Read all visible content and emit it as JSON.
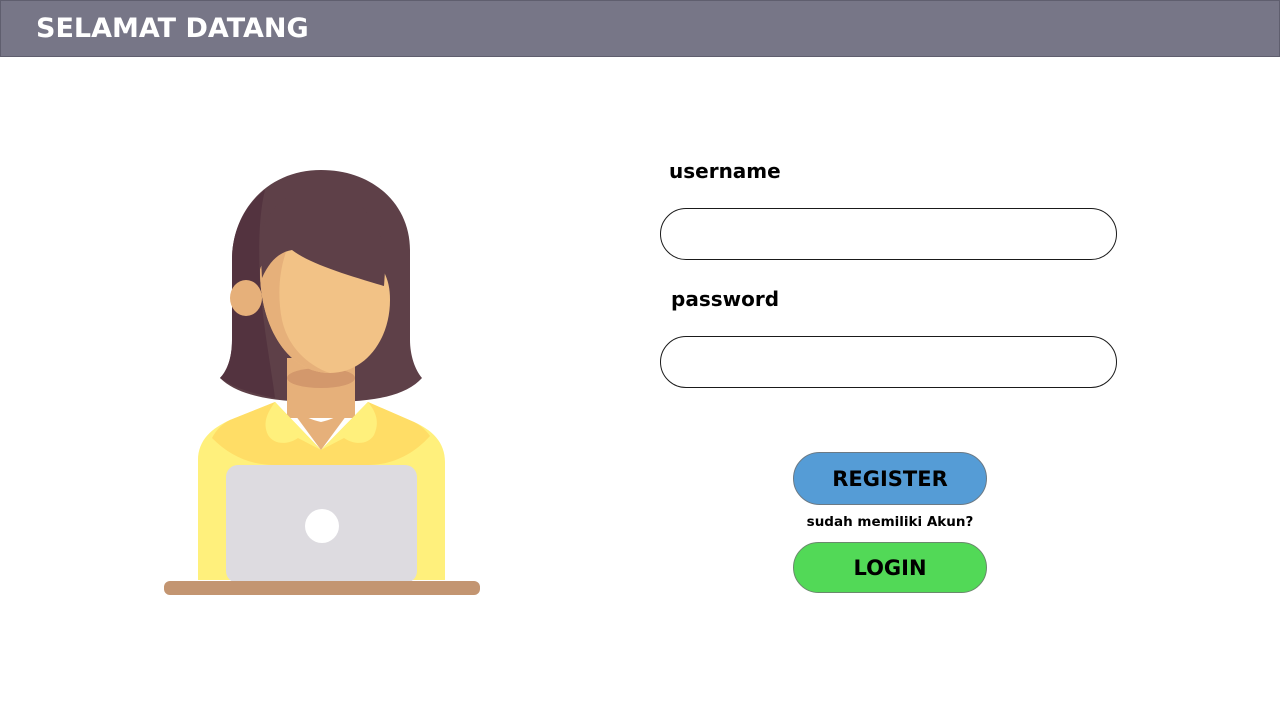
{
  "header": {
    "title": "SELAMAT DATANG"
  },
  "illustration": {
    "icon": "woman-with-laptop-illustration"
  },
  "form": {
    "username_label": "username",
    "username_value": "",
    "password_label": "password",
    "password_value": "",
    "register_label": "REGISTER",
    "helper_text": "sudah memiliki Akun?",
    "login_label": "LOGIN"
  },
  "colors": {
    "header_bg": "#777687",
    "register_bg": "#559cd6",
    "login_bg": "#52d957",
    "hair": "#5e4048",
    "skin": "#f2c286",
    "shirt": "#ffe066",
    "laptop": "#dddbe0",
    "desk": "#c39571"
  }
}
